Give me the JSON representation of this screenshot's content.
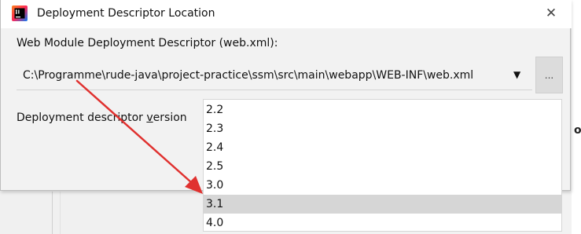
{
  "dialog": {
    "title": "Deployment Descriptor Location",
    "close_glyph": "✕",
    "icon": "intellij-app-icon"
  },
  "descriptor": {
    "label": "Web Module Deployment Descriptor (web.xml):",
    "path": "C:\\Programme\\rude-java\\project-practice\\ssm\\src\\main\\webapp\\WEB-INF\\web.xml",
    "dropdown_glyph": "▼",
    "browse_label": "..."
  },
  "version": {
    "label_before": "Deployment descriptor ",
    "label_mnemonic": "v",
    "label_after": "ersion",
    "options": [
      "2.2",
      "2.3",
      "2.4",
      "2.5",
      "3.0",
      "3.1",
      "4.0"
    ],
    "selected": "3.1"
  },
  "background": {
    "right_glyph": "o"
  },
  "colors": {
    "annotation_arrow": "#e0312f",
    "selection": "#d6d6d6"
  }
}
